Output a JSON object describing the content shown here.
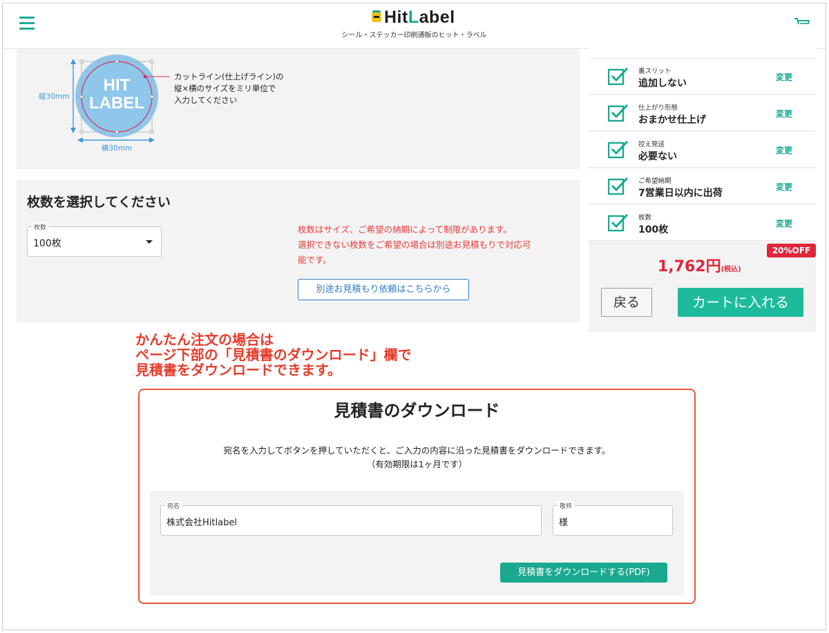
{
  "header": {
    "logo_prefix": "Hit",
    "logo_l": "L",
    "logo_suffix": "abel",
    "tagline": "シール・ステッカー印刷通販のヒット・ラベル",
    "icons": {
      "menu": "hamburger-icon",
      "cart": "cart-icon"
    }
  },
  "size_guide": {
    "circle_text_line1": "HIT",
    "circle_text_line2": "LABEL",
    "height_label": "縦30mm",
    "width_label": "横30mm",
    "note_line1": "カットライン(仕上げライン)の",
    "note_line2": "縦×横のサイズをミリ単位で",
    "note_line3": "入力してください"
  },
  "quantity": {
    "title": "枚数を選択してください",
    "select_legend": "枚数",
    "select_value": "100枚",
    "note_line1": "枚数はサイズ、ご希望の納期によって制限があります。",
    "note_line2": "選択できない枚数をご希望の場合は別途お見積もりで対応可",
    "note_line3": "能です。",
    "estimate_button": "別途お見積もり依頼はこちらから"
  },
  "sidebar": {
    "options": [
      {
        "label": "裏スリット",
        "value": "追加しない",
        "change": "変更"
      },
      {
        "label": "仕上がり形態",
        "value": "おまかせ仕上げ",
        "change": "変更"
      },
      {
        "label": "控え発送",
        "value": "必要ない",
        "change": "変更"
      },
      {
        "label": "ご希望納期",
        "value": "7営業日以内に出荷",
        "change": "変更"
      },
      {
        "label": "枚数",
        "value": "100枚",
        "change": "変更"
      }
    ],
    "discount_badge": "20%OFF",
    "price": "1,762円",
    "price_tax": "(税込)",
    "back_button": "戻る",
    "cart_button": "カートに入れる"
  },
  "annotation": {
    "line1": "かんたん注文の場合は",
    "line2": "ページ下部の「見積書のダウンロード」欄で",
    "line3": "見積書をダウンロードできます。"
  },
  "download": {
    "title": "見積書のダウンロード",
    "desc_line1": "宛名を入力してボタンを押していただくと、ご入力の内容に沿った見積書をダウンロードできます。",
    "desc_line2": "（有効期限は1ヶ月です）",
    "name_legend": "宛名",
    "name_value": "株式会社Hitlabel",
    "honorific_legend": "敬称",
    "honorific_value": "様",
    "download_button": "見積書をダウンロードする(PDF)"
  },
  "colors": {
    "accent": "#1aa98f",
    "danger": "#e0263c",
    "annotation": "#e63b2a",
    "panel": "#f3f3f3"
  }
}
